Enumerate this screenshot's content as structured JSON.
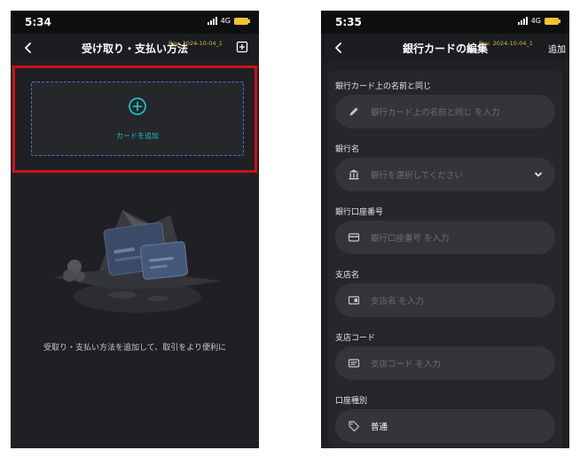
{
  "left_screen": {
    "status": {
      "time": "5:34",
      "network": "4G"
    },
    "header": {
      "title": "受け取り・支払い方法",
      "rev": "Rev. 2024-10-04_1"
    },
    "add_card_label": "カードを追加",
    "empty_text": "受取り・支払い方法を追加して、取引をより便利に"
  },
  "right_screen": {
    "status": {
      "time": "5:35",
      "network": "4G"
    },
    "header": {
      "title": "銀行カードの編集",
      "rev": "Rev. 2024-10-04_1",
      "action": "追加"
    },
    "fields": [
      {
        "label": "銀行カード上の名前と同じ",
        "placeholder": "銀行カード上の名前と同じ を入力",
        "icon": "pencil-icon"
      },
      {
        "label": "銀行名",
        "placeholder": "銀行を選択してください",
        "icon": "bank-icon"
      },
      {
        "label": "銀行口座番号",
        "placeholder": "銀行口座番号 を入力",
        "icon": "card-icon"
      },
      {
        "label": "支店名",
        "placeholder": "支店名 を入力",
        "icon": "branch-icon"
      },
      {
        "label": "支店コード",
        "placeholder": "支店コード を入力",
        "icon": "code-icon"
      },
      {
        "label": "口座種別",
        "value": "普通",
        "icon": "tag-icon"
      }
    ]
  },
  "colors": {
    "background": "#1f2023",
    "accent_teal": "#1fbfbf",
    "highlight_red": "#d0101a",
    "dashed_border": "#4e6fd2",
    "rev_text": "#d8b84a",
    "battery": "#f2c230"
  }
}
